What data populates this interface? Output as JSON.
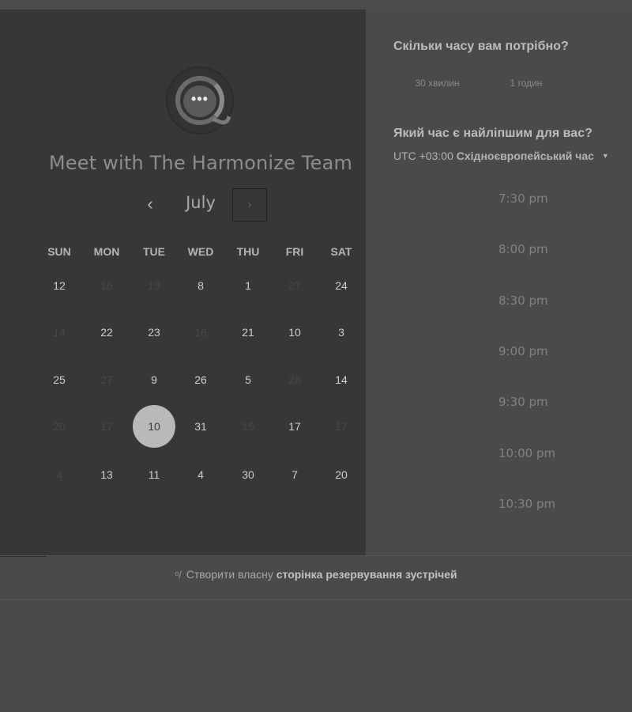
{
  "left": {
    "title": "Meet with The Harmonize Team",
    "logo_icon": "chat-bubble-icon",
    "logo_text": "•••",
    "month": "July",
    "prev_icon": "‹",
    "next_icon": "›",
    "weekdays": [
      "SUN",
      "MON",
      "TUE",
      "WED",
      "THU",
      "FRI",
      "SAT"
    ],
    "weeks": [
      [
        {
          "d": "12",
          "on": true
        },
        {
          "d": "16",
          "on": false
        },
        {
          "d": "19",
          "on": false
        },
        {
          "d": "8",
          "on": true
        },
        {
          "d": "1",
          "on": true
        },
        {
          "d": "27",
          "on": false
        },
        {
          "d": "24",
          "on": true
        }
      ],
      [
        {
          "d": "14",
          "on": false
        },
        {
          "d": "22",
          "on": true
        },
        {
          "d": "23",
          "on": true
        },
        {
          "d": "16",
          "on": false
        },
        {
          "d": "21",
          "on": true
        },
        {
          "d": "10",
          "on": true
        },
        {
          "d": "3",
          "on": true
        }
      ],
      [
        {
          "d": "25",
          "on": true
        },
        {
          "d": "27",
          "on": false
        },
        {
          "d": "9",
          "on": true
        },
        {
          "d": "26",
          "on": true
        },
        {
          "d": "5",
          "on": true
        },
        {
          "d": "28",
          "on": false
        },
        {
          "d": "14",
          "on": true
        }
      ],
      [
        {
          "d": "20",
          "on": false
        },
        {
          "d": "17",
          "on": false
        },
        {
          "d": "10",
          "on": true,
          "selected": true
        },
        {
          "d": "31",
          "on": true
        },
        {
          "d": "15",
          "on": false
        },
        {
          "d": "17",
          "on": true
        },
        {
          "d": "17",
          "on": false
        }
      ],
      [
        {
          "d": "4",
          "on": false
        },
        {
          "d": "13",
          "on": true
        },
        {
          "d": "11",
          "on": true
        },
        {
          "d": "4",
          "on": true
        },
        {
          "d": "30",
          "on": true
        },
        {
          "d": "7",
          "on": true
        },
        {
          "d": "20",
          "on": true
        }
      ]
    ]
  },
  "right": {
    "duration_question": "Скільки часу вам потрібно?",
    "durations": [
      "30 хвилин",
      "1 годин"
    ],
    "time_question": "Який час є найліпшим для вас?",
    "timezone_offset": "UTC +03:00",
    "timezone_name": "Східноєвропейський час",
    "timezone_caret": "▼",
    "slots": [
      "7:30 pm",
      "8:00 pm",
      "8:30 pm",
      "9:00 pm",
      "9:30 pm",
      "10:00 pm",
      "10:30 pm"
    ]
  },
  "footer": {
    "icon": "sprocket-icon",
    "icon_glyph": "ᵒ/",
    "prefix": "Створити власну",
    "link": "сторінка резервування зустрічей"
  }
}
